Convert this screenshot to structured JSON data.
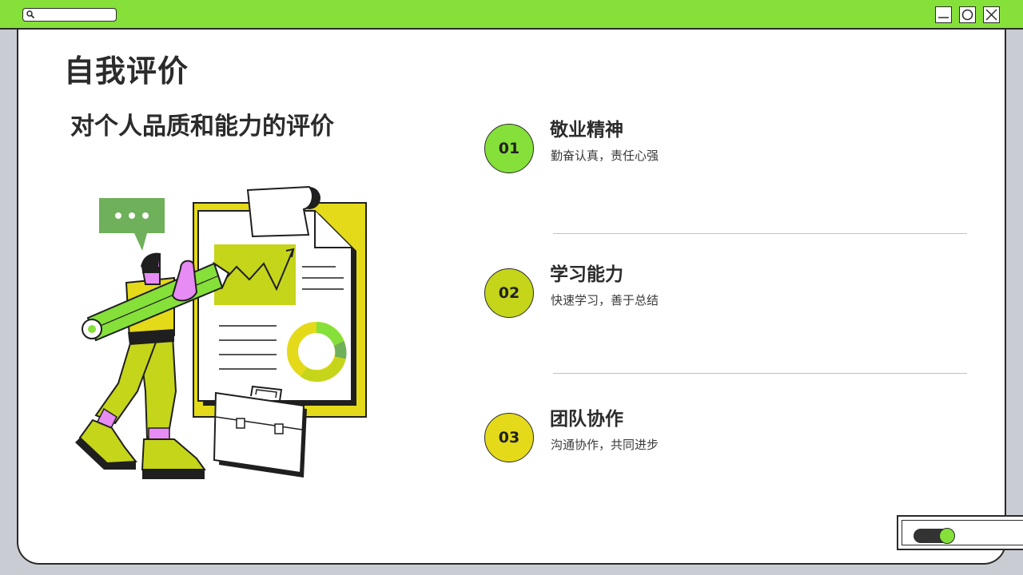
{
  "window": {
    "title_bar_color": "#86e03a",
    "controls": [
      "minimize-icon",
      "maximize-icon",
      "close-icon"
    ]
  },
  "page": {
    "title": "自我评价",
    "subtitle": "对个人品质和能力的评价"
  },
  "items": [
    {
      "number": "01",
      "title": "敬业精神",
      "description": "勤奋认真，责任心强",
      "color": "#86e03a"
    },
    {
      "number": "02",
      "title": "学习能力",
      "description": "快速学习，善于总结",
      "color": "#c5d51a"
    },
    {
      "number": "03",
      "title": "团队协作",
      "description": "沟通协作，共同进步",
      "color": "#e4da1a"
    }
  ],
  "colors": {
    "accent_green": "#86e03a",
    "accent_lime": "#c5d51a",
    "accent_yellow": "#e4da1a",
    "divider": "#b7c3d6"
  }
}
